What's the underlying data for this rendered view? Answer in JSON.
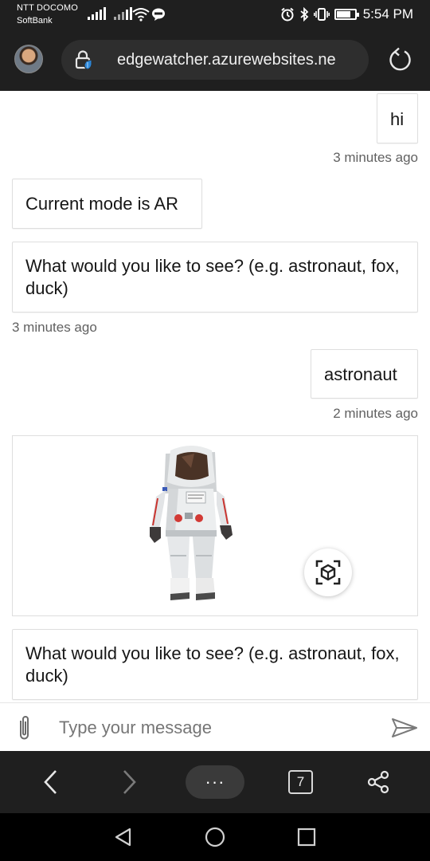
{
  "status_bar": {
    "carrier_primary": "NTT DOCOMO",
    "carrier_secondary": "SoftBank",
    "time": "5:54 PM"
  },
  "address_bar": {
    "url": "edgewatcher.azurewebsites.ne"
  },
  "chat": {
    "messages": [
      {
        "from": "user",
        "text": "hi",
        "timestamp": "3 minutes ago"
      },
      {
        "from": "bot",
        "text": "Current mode is AR"
      },
      {
        "from": "bot",
        "text": "What would you like to see? (e.g. astronaut, fox, duck)",
        "timestamp": "3 minutes ago"
      },
      {
        "from": "user",
        "text": "astronaut",
        "timestamp": "2 minutes ago"
      },
      {
        "from": "bot",
        "type": "3d-model-card",
        "model": "astronaut",
        "action_icon": "ar-view-icon"
      },
      {
        "from": "bot",
        "text": "What would you like to see? (e.g. astronaut, fox, duck)"
      }
    ]
  },
  "composer": {
    "placeholder": "Type your message"
  },
  "browser_bar": {
    "more_label": "···",
    "tab_count": "7"
  },
  "colors": {
    "chrome_dark": "#1f1f1f",
    "bubble_border": "#dedede",
    "timestamp": "#616161"
  }
}
